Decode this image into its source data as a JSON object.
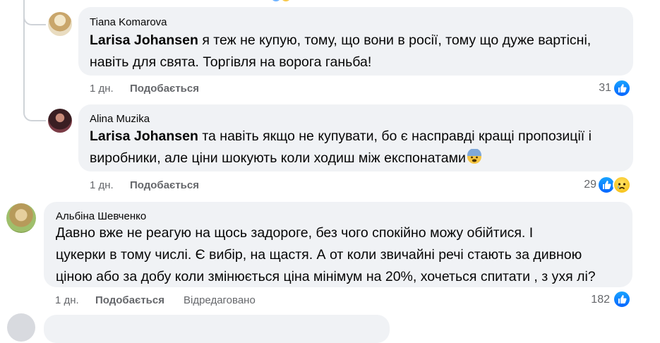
{
  "comments": [
    {
      "author": "Tiana Komarova",
      "mention": "Larisa Johansen",
      "lines": [
        " я теж не купую, тому, що вони в росії, тому що дуже вартісні,",
        "навіть для свята. Торгівля на ворога ганьба!"
      ],
      "time": "1 дн.",
      "like_label": "Подобається",
      "reactions": "31",
      "reaction_icons": [
        "like-icon"
      ]
    },
    {
      "author": "Alina Muzika",
      "mention": "Larisa Johansen",
      "lines": [
        " та навіть якщо не купувати, бо є насправді кращі пропозиції і",
        "виробники, але ціни шокують коли ходиш між експонатами"
      ],
      "time": "1 дн.",
      "like_label": "Подобається",
      "reactions": "29",
      "reaction_icons": [
        "like-icon",
        "sad-icon"
      ]
    },
    {
      "author": "Альбіна Шевченко",
      "lines": [
        "Давно вже не реагую на щось задороге, без чого спокійно можу обійтися. І",
        "цукерки в тому числі. Є вибір, на щастя. А от коли звичайні речі стають за дивною",
        "ціною або за добу коли змінюється ціна мінімум на 20%, хочеться спитати , з ухя лі?"
      ],
      "time": "1 дн.",
      "like_label": "Подобається",
      "edited_label": "Відредаговано",
      "reactions": "182",
      "reaction_icons": [
        "like-icon"
      ]
    }
  ],
  "colors": {
    "bubble": "#f0f2f5",
    "meta": "#65676b",
    "like_blue": "#0866ff",
    "thread_line": "#cfd3d8"
  }
}
